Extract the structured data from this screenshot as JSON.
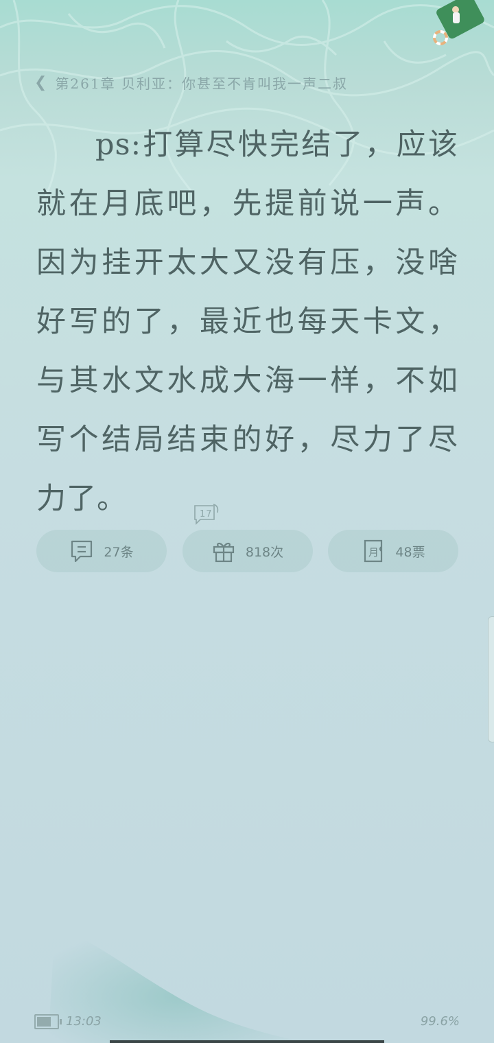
{
  "header": {
    "back_icon": "chevron-left",
    "chapter_title": "第261章 贝利亚：你甚至不肯叫我一声二叔"
  },
  "content": {
    "paragraph": "ps:打算尽快完结了，应该就在月底吧，先提前说一声。因为挂开太大又没有压，没啥好写的了，最近也每天卡文，与其水文水成大海一样，不如写个结局结束的好，尽力了尽力了。",
    "note_count": "17"
  },
  "actions": [
    {
      "icon": "comment-icon",
      "label": "27条"
    },
    {
      "icon": "gift-icon",
      "label": "818次"
    },
    {
      "icon": "monthly-ticket-icon",
      "label": "48票"
    }
  ],
  "footer": {
    "time": "13:03",
    "progress": "99.6%",
    "battery_level": 0.7
  },
  "colors": {
    "text": "#4f6464",
    "accent": "#6d8586"
  }
}
